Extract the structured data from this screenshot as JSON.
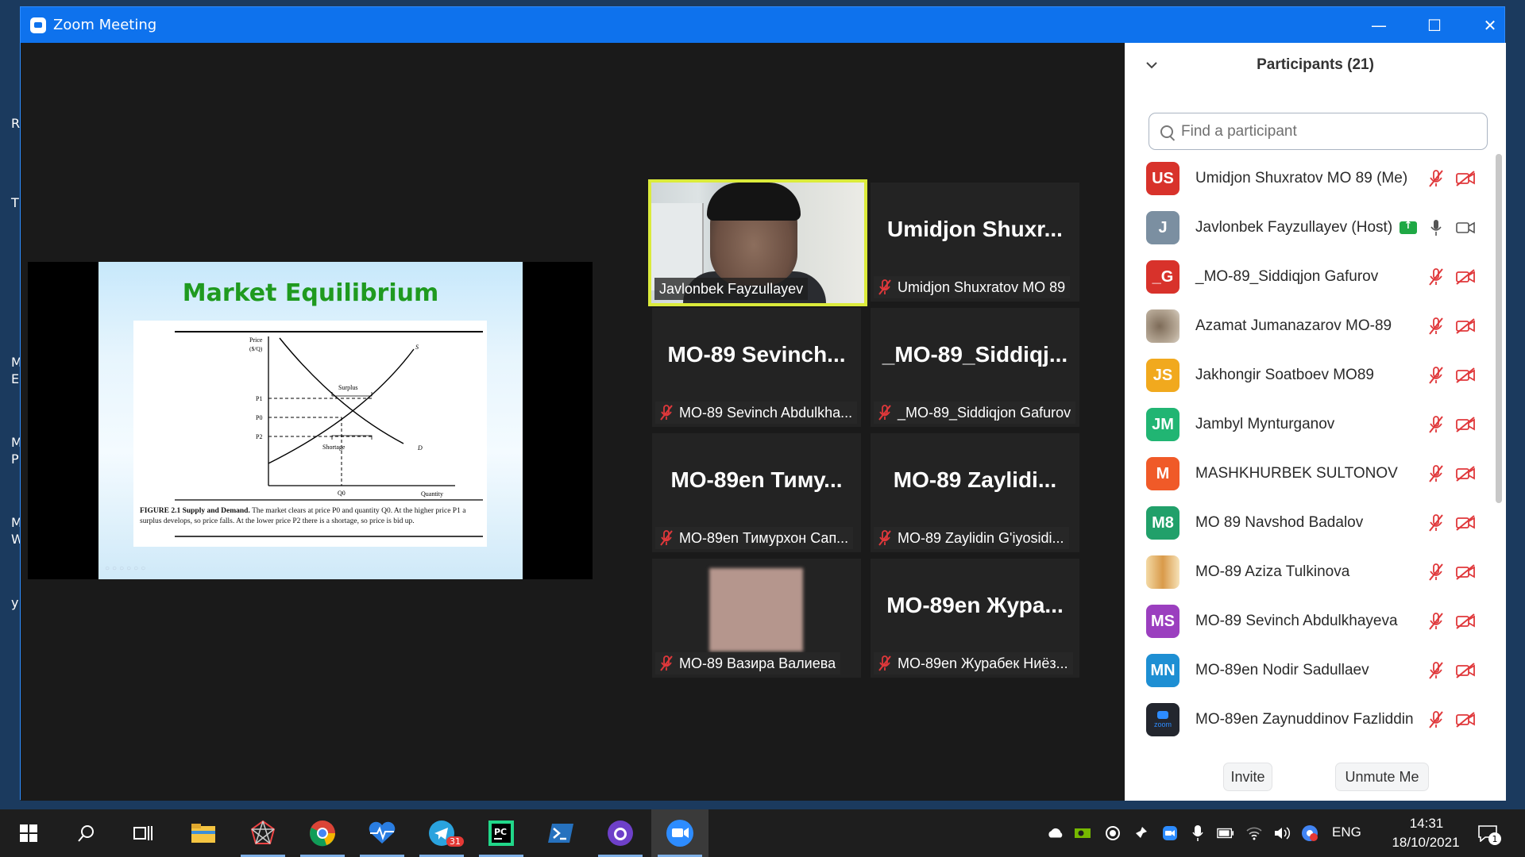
{
  "window": {
    "title": "Zoom Meeting",
    "minimize": "—",
    "maximize": "☐",
    "close": "✕"
  },
  "desktop_labels": [
    "R",
    "T",
    "M",
    "E",
    "M",
    "P",
    "M",
    "W",
    "y"
  ],
  "shared_slide": {
    "title": "Market Equilibrium",
    "figure": {
      "price_axis": "Price",
      "price_unit": "($/Q)",
      "quantity_axis": "Quantity",
      "p1": "P1",
      "p0": "P0",
      "p2": "P2",
      "q0": "Q0",
      "surplus": "Surplus",
      "shortage": "Shortage",
      "s_curve": "S",
      "d_curve": "D"
    },
    "caption_bold": "FIGURE 2.1   Supply and Demand.",
    "caption_text": " The market clears at price P0 and quantity Q0. At the higher price P1 a surplus develops, so price falls. At the lower price P2 there is a shortage, so price is bid up."
  },
  "tiles": [
    {
      "big": "",
      "label": "Javlonbek Fayzullayev",
      "muted": false,
      "video": true
    },
    {
      "big": "Umidjon  Shuxr...",
      "label": "Umidjon Shuxratov MO 89",
      "muted": true
    },
    {
      "big": "MO-89  Sevinch...",
      "label": "MO-89 Sevinch Abdulkha...",
      "muted": true
    },
    {
      "big": "_MO-89_Siddiqj...",
      "label": "_MO-89_Siddiqjon Gafurov",
      "muted": true
    },
    {
      "big": "MO-89en  Тиму...",
      "label": "MO-89en Тимурхон Сап...",
      "muted": true
    },
    {
      "big": "MO-89   Zaylidi...",
      "label": "MO-89  Zaylidin G'iyosidi...",
      "muted": true
    },
    {
      "big": "",
      "label": "MO-89 Вазира Валиева",
      "muted": true,
      "blurred": true
    },
    {
      "big": "MO-89en  Жура...",
      "label": "MO-89en Журабек Ниёз...",
      "muted": true
    }
  ],
  "participants_panel": {
    "header": "Participants (21)",
    "search_placeholder": "Find a participant",
    "items": [
      {
        "initials": "US",
        "color": "#d8322b",
        "name": "Umidjon Shuxratov MO 89 (Me)",
        "muted": true,
        "video_off": true
      },
      {
        "initials": "J",
        "color": "#7b8fa1",
        "name": "Javlonbek Fayzullayev (Host)",
        "muted": false,
        "video_off": false,
        "sharing": true
      },
      {
        "initials": "_G",
        "color": "#d8322b",
        "name": "_MO-89_Siddiqjon Gafurov",
        "muted": true,
        "video_off": true
      },
      {
        "initials": "",
        "color": "#9a8a78",
        "name": "Azamat Jumanazarov MO-89",
        "muted": true,
        "video_off": true,
        "photo": true
      },
      {
        "initials": "JS",
        "color": "#f1a91e",
        "name": "Jakhongir Soatboev MO89",
        "muted": true,
        "video_off": true
      },
      {
        "initials": "JM",
        "color": "#21b573",
        "name": "Jambyl Mynturganov",
        "muted": true,
        "video_off": true
      },
      {
        "initials": "M",
        "color": "#f05a28",
        "name": "MASHKHURBEK SULTONOV",
        "muted": true,
        "video_off": true
      },
      {
        "initials": "M8",
        "color": "#21a06a",
        "name": "MO 89 Navshod Badalov",
        "muted": true,
        "video_off": true
      },
      {
        "initials": "",
        "color": "#e8b35c",
        "name": "MO-89 Aziza Tulkinova",
        "muted": true,
        "video_off": true,
        "photo": true
      },
      {
        "initials": "MS",
        "color": "#9b3fbf",
        "name": "MO-89 Sevinch Abdulkhayeva",
        "muted": true,
        "video_off": true
      },
      {
        "initials": "MN",
        "color": "#1e8fd3",
        "name": "MO-89en Nodir Sadullaev",
        "muted": true,
        "video_off": true
      },
      {
        "initials": "zoom",
        "color": "#23262e",
        "name": "MO-89en Zaynuddinov Fazliddin",
        "muted": true,
        "video_off": true
      }
    ],
    "invite_label": "Invite",
    "unmute_label": "Unmute Me"
  },
  "taskbar": {
    "apps": [
      "start-icon",
      "search-icon",
      "task-view-icon",
      "file-explorer-icon",
      "network-app-icon",
      "chrome-icon",
      "health-app-icon",
      "telegram-icon",
      "pycharm-icon",
      "powershell-icon",
      "github-icon",
      "zoom-icon"
    ],
    "telegram_badge": "31",
    "language": "ENG",
    "time": "14:31",
    "date": "18/10/2021",
    "notification_count": "1"
  }
}
